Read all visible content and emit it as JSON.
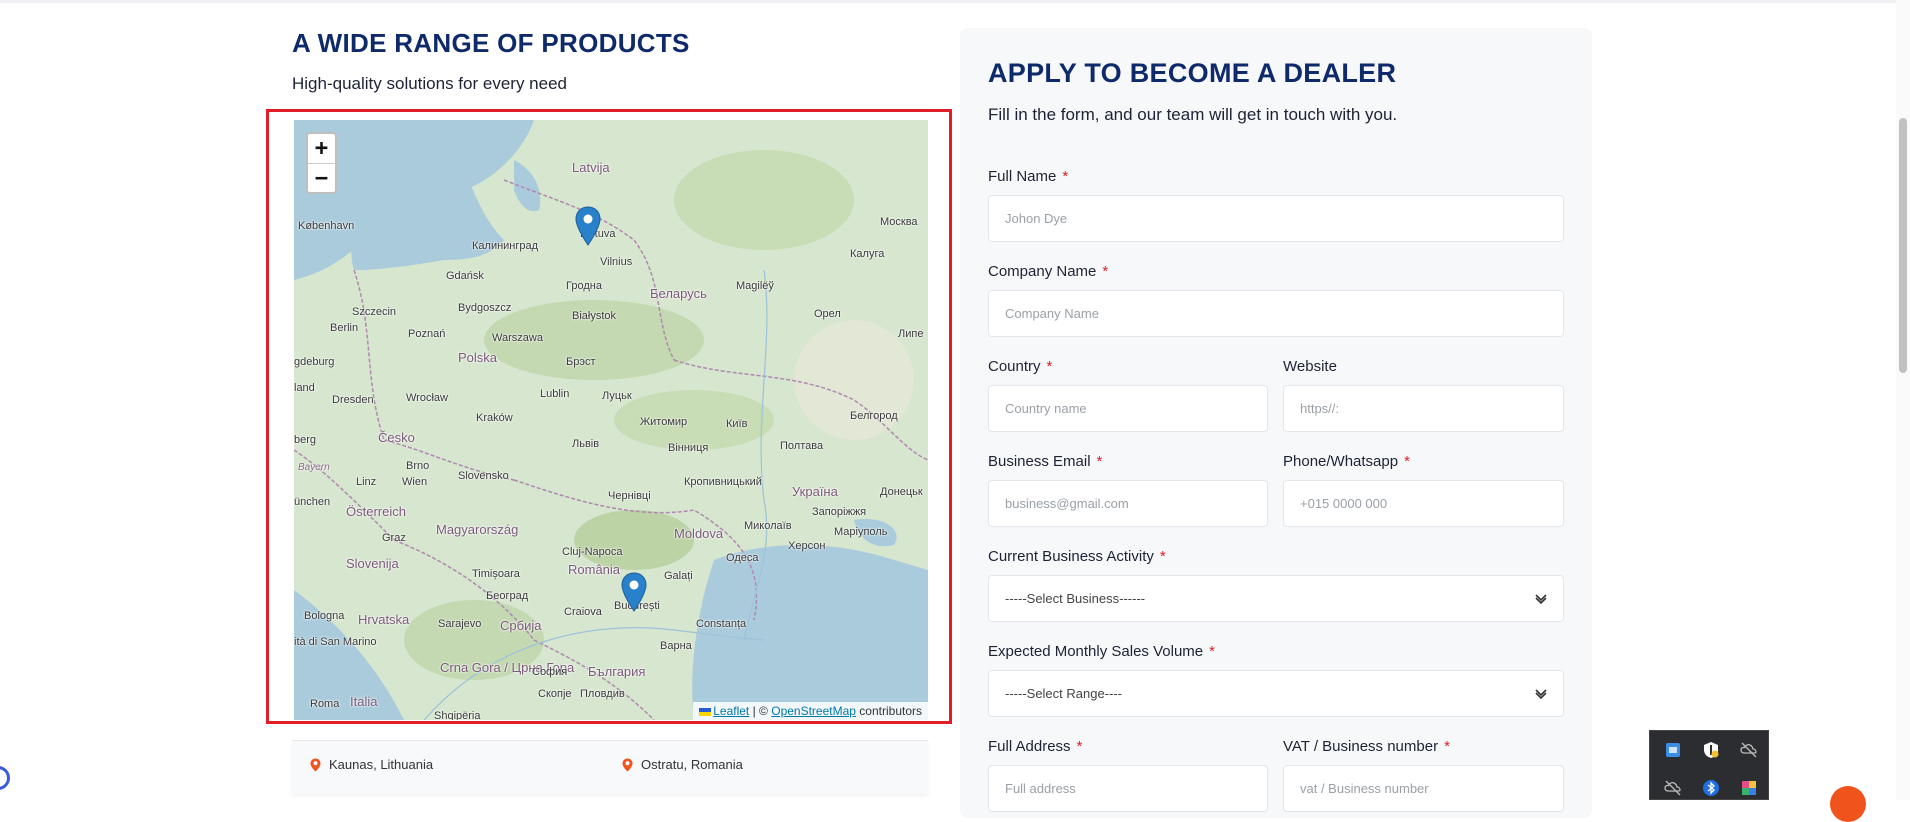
{
  "left": {
    "title": "A WIDE RANGE OF PRODUCTS",
    "subtitle": "High-quality solutions for every need"
  },
  "map": {
    "zoom_in": "+",
    "zoom_out": "−",
    "attribution": {
      "leaflet": "Leaflet",
      "separator": "| ©",
      "osm": "OpenStreetMap",
      "suffix": "contributors"
    },
    "labels": {
      "latvija": "Latvija",
      "lietuva": "Lietuva",
      "kobenhavn": "København",
      "kaliningrad": "Калининград",
      "gdansk": "Gdańsk",
      "vilnius": "Vilnius",
      "moskva": "Москва",
      "kaluga": "Калуга",
      "belarus": "Беларусь",
      "grodno": "Гродна",
      "mogilev": "Magilёў",
      "szczecin": "Szczecin",
      "bydgoszcz": "Bydgoszcz",
      "bialystok": "Białystok",
      "berlin": "Berlin",
      "poznan": "Poznań",
      "warszawa": "Warszawa",
      "orel": "Орел",
      "lipe": "Липе",
      "polska": "Polska",
      "brest": "Брэст",
      "magdeburg": "gdeburg",
      "land": "land",
      "dresden": "Dresden",
      "wroclaw": "Wrocław",
      "lublin": "Lublin",
      "lutsk": "Луцьк",
      "belgorod": "Белгород",
      "cesko": "Česko",
      "krakow": "Kraków",
      "zhytomyr": "Житомир",
      "kyiv": "Київ",
      "berg": "berg",
      "brno": "Brno",
      "lviv": "Львів",
      "vinnytsia": "Вінниця",
      "poltava": "Полтава",
      "bayern": "Bayern",
      "slovensko": "Slovensko",
      "linz": "Linz",
      "wien": "Wien",
      "kropyvnytskyi": "Кропивницький",
      "ukraina": "Україна",
      "donetsk": "Донецьк",
      "munchen": "ünchen",
      "osterreich": "Österreich",
      "chernivtsi": "Чернівці",
      "zaporizhzhia": "Запоріжжя",
      "graz": "Graz",
      "magyarorszag": "Magyarország",
      "moldova": "Moldova",
      "mykolaiv": "Миколаїв",
      "mariupol": "Маріуполь",
      "kherson": "Херсон",
      "slovenija": "Slovenija",
      "cluj": "Cluj-Napoca",
      "odesa": "Одеса",
      "romania": "România",
      "timisoara": "Timișoara",
      "galati": "Galați",
      "beograd": "Београд",
      "craiova": "Craiova",
      "bucuresti": "București",
      "bologna": "Bologna",
      "hrvatska": "Hrvatska",
      "sarajevo": "Sarajevo",
      "srbija": "Србија",
      "constanta": "Constanța",
      "sanmarino": "ità di San Marino",
      "varna": "Варна",
      "crnagora": "Crna Gora / Црна Гора",
      "sofia": "София",
      "bulgaria": "България",
      "skopje": "Скопје",
      "plovdiv": "Пловдив",
      "roma": "Roma",
      "italia": "Italia",
      "shqiperia": "Shqipëria"
    }
  },
  "locations": [
    {
      "name": "Kaunas, Lithuania"
    },
    {
      "name": "Ostratu, Romania"
    }
  ],
  "form": {
    "title": "APPLY TO BECOME A DEALER",
    "subtitle": "Fill in the form, and our team will get in touch with you.",
    "required_mark": "*",
    "full_name": {
      "label": "Full Name",
      "placeholder": "Johon Dye"
    },
    "company_name": {
      "label": "Company Name",
      "placeholder": "Company Name"
    },
    "country": {
      "label": "Country",
      "placeholder": "Country name"
    },
    "website": {
      "label": "Website",
      "placeholder": "https//:"
    },
    "email": {
      "label": "Business Email",
      "placeholder": "business@gmail.com"
    },
    "phone": {
      "label": "Phone/Whatsapp",
      "placeholder": "+015 0000 000"
    },
    "business_activity": {
      "label": "Current Business Activity",
      "selected": "-----Select Business------"
    },
    "sales_volume": {
      "label": "Expected Monthly Sales Volume",
      "selected": "-----Select Range----"
    },
    "address": {
      "label": "Full Address",
      "placeholder": "Full address"
    },
    "vat": {
      "label": "VAT / Business number",
      "placeholder": "vat / Business number"
    }
  },
  "colors": {
    "heading": "#0f2a6b",
    "required": "#e11d27",
    "map_outline": "#e11d27",
    "marker": "#2a81cb",
    "location_pin": "#f0531c"
  }
}
